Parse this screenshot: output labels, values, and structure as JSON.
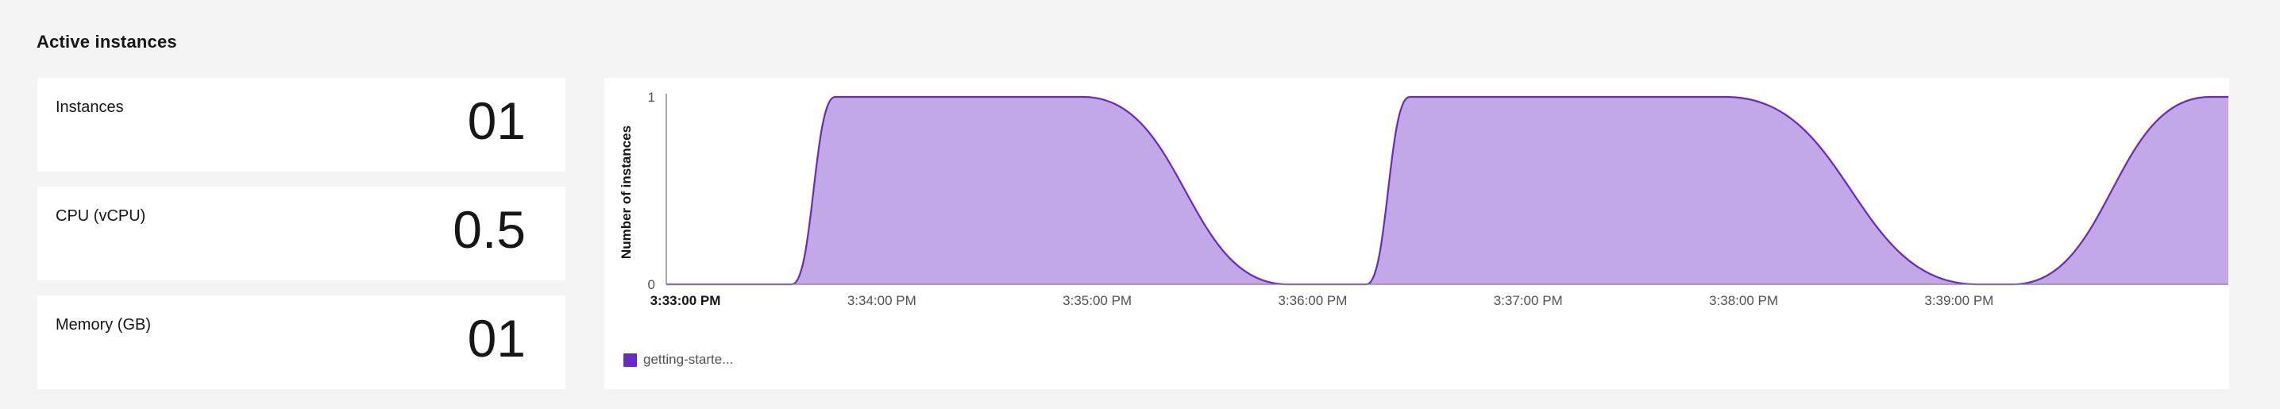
{
  "section": {
    "title": "Active instances"
  },
  "tiles": [
    {
      "label": "Instances",
      "value": "01"
    },
    {
      "label": "CPU (vCPU)",
      "value": "0.5"
    },
    {
      "label": "Memory (GB)",
      "value": "01"
    }
  ],
  "chart_data": {
    "type": "area",
    "ylabel": "Number of instances",
    "xlabel": "",
    "ylim": [
      0,
      1
    ],
    "y_ticks": [
      "0",
      "1"
    ],
    "x_ticks": [
      "3:33:00 PM",
      "3:34:00 PM",
      "3:35:00 PM",
      "3:36:00 PM",
      "3:37:00 PM",
      "3:38:00 PM",
      "3:39:00 PM"
    ],
    "x_range": [
      "3:33:00 PM",
      "3:40:15 PM"
    ],
    "series": [
      {
        "name": "getting-starte...",
        "color": "#6929c4",
        "fill": "#c3a8e8",
        "points": [
          {
            "x": "3:33:00 PM",
            "y": 0
          },
          {
            "x": "3:33:35 PM",
            "y": 0
          },
          {
            "x": "3:33:47 PM",
            "y": 1
          },
          {
            "x": "3:34:56 PM",
            "y": 1
          },
          {
            "x": "3:35:53 PM",
            "y": 0
          },
          {
            "x": "3:36:15 PM",
            "y": 0
          },
          {
            "x": "3:36:27 PM",
            "y": 1
          },
          {
            "x": "3:37:55 PM",
            "y": 1
          },
          {
            "x": "3:39:05 PM",
            "y": 0
          },
          {
            "x": "3:39:15 PM",
            "y": 0
          },
          {
            "x": "3:40:10 PM",
            "y": 1
          },
          {
            "x": "3:40:15 PM",
            "y": 1
          }
        ]
      }
    ]
  },
  "legend": {
    "label": "getting-starte...",
    "color": "#6929c4"
  }
}
